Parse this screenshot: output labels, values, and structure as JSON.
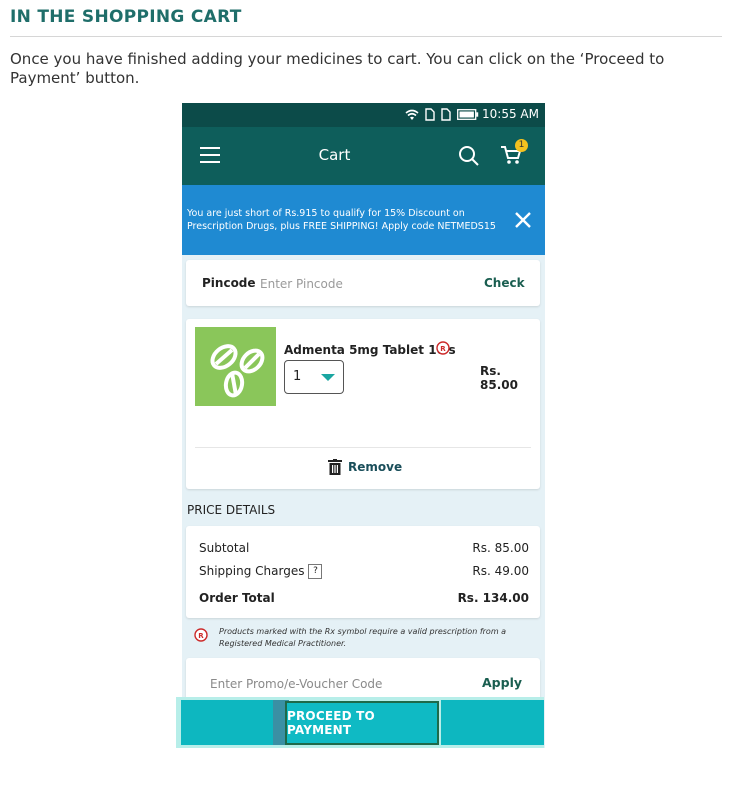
{
  "heading": "IN THE SHOPPING CART",
  "intro": "Once you have finished adding your medicines to cart. You can click on the ‘Proceed to Payment’ button.",
  "status_bar": {
    "time": "10:55 AM"
  },
  "app_bar": {
    "title": "Cart",
    "cart_badge": "1"
  },
  "banner": {
    "text": "You are just short of Rs.915 to qualify for 15% Discount on Prescription Drugs, plus FREE SHIPPING! Apply code NETMEDS15"
  },
  "pincode": {
    "label": "Pincode",
    "placeholder": "Enter Pincode",
    "check_label": "Check"
  },
  "cart_item": {
    "name": "Admenta 5mg Tablet 10's",
    "quantity": "1",
    "price": "Rs. 85.00",
    "remove_label": "Remove"
  },
  "price_details": {
    "heading": "PRICE DETAILS",
    "subtotal_label": "Subtotal",
    "subtotal_value": "Rs. 85.00",
    "shipping_label": "Shipping Charges",
    "shipping_help": "?",
    "shipping_value": "Rs. 49.00",
    "total_label": "Order Total",
    "total_value": "Rs. 134.00"
  },
  "disclaimer": "Products marked with the Rx symbol require a valid prescription from a Registered Medical Practitioner.",
  "promo": {
    "placeholder": "Enter Promo/e-Voucher Code",
    "apply_label": "Apply"
  },
  "proceed_button": "PROCEED TO PAYMENT",
  "colors": {
    "app_bar": "#0e5e5b",
    "banner": "#1f8ad2",
    "accent": "#0fbac4",
    "product_image": "#8ac65a"
  }
}
